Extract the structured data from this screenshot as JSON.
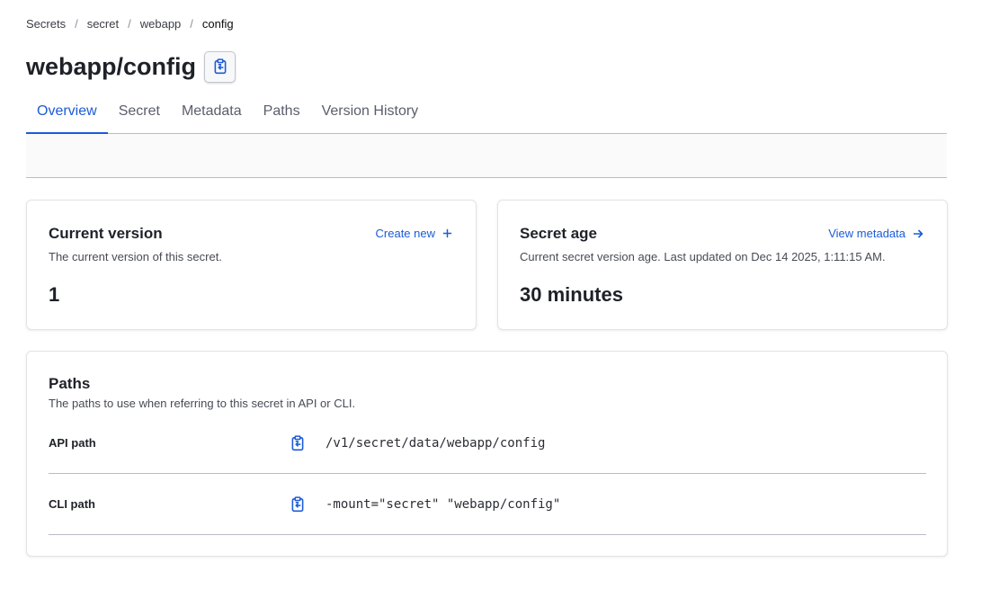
{
  "breadcrumb": {
    "items": [
      "Secrets",
      "secret",
      "webapp"
    ],
    "current": "config",
    "separator": "/"
  },
  "page": {
    "title": "webapp/config"
  },
  "tabs": [
    {
      "label": "Overview",
      "active": true
    },
    {
      "label": "Secret",
      "active": false
    },
    {
      "label": "Metadata",
      "active": false
    },
    {
      "label": "Paths",
      "active": false
    },
    {
      "label": "Version History",
      "active": false
    }
  ],
  "current_version": {
    "title": "Current version",
    "description": "The current version of this secret.",
    "value": "1",
    "action_label": "Create new",
    "action_icon": "plus-icon"
  },
  "secret_age": {
    "title": "Secret age",
    "description": "Current secret version age. Last updated on Dec 14 2025, 1:11:15 AM.",
    "value": "30 minutes",
    "action_label": "View metadata",
    "action_icon": "arrow-right-icon"
  },
  "paths": {
    "title": "Paths",
    "description": "The paths to use when referring to this secret in API or CLI.",
    "rows": [
      {
        "label": "API path",
        "value": "/v1/secret/data/webapp/config",
        "icon": "clipboard-copy-icon"
      },
      {
        "label": "CLI path",
        "value": "-mount=\"secret\" \"webapp/config\"",
        "icon": "clipboard-copy-icon"
      }
    ]
  },
  "colors": {
    "accent": "#1c5bd7",
    "border": "#b9bcc3",
    "text": "#1f2128"
  }
}
